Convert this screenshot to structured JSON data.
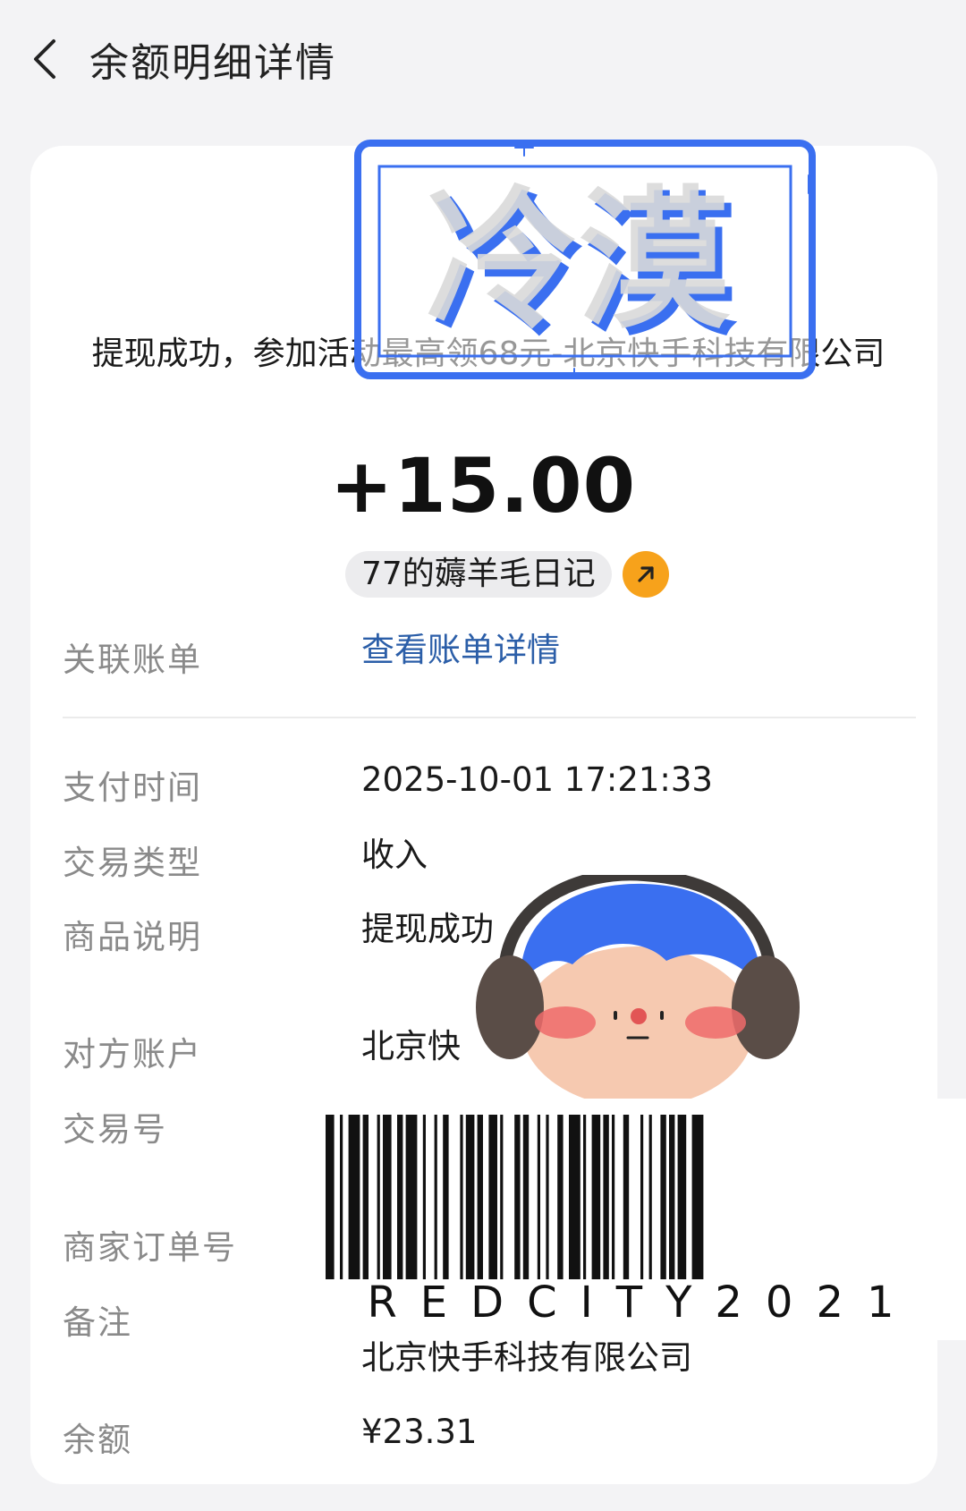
{
  "header": {
    "title": "余额明细详情",
    "back_icon": "chevron-left-icon"
  },
  "summary": {
    "description": "提现成功，参加活动最高领68元-北京快手科技有限公司",
    "amount": "+15.00",
    "chip_label": "77的薅羊毛日记",
    "chip_icon": "arrow-up-right-icon",
    "chip_icon_color": "#f7a21b"
  },
  "related": {
    "label": "关联账单",
    "link_text": "查看账单详情",
    "link_color": "#2b5ea8"
  },
  "details": {
    "pay_time": {
      "label": "支付时间",
      "value": "2025-10-01 17:21:33"
    },
    "trade_type": {
      "label": "交易类型",
      "value": "收入"
    },
    "product_desc": {
      "label": "商品说明",
      "value": "提现成功"
    },
    "counterparty": {
      "label": "对方账户",
      "value": "北京快"
    },
    "trade_no": {
      "label": "交易号"
    },
    "order_no": {
      "label": "商家订单号"
    },
    "remark": {
      "label": "备注",
      "value": "北京快手科技有限公司"
    },
    "balance": {
      "label": "余额",
      "value": "¥23.31"
    }
  },
  "overlays": {
    "stamp": {
      "text": "冷漠",
      "color": "#3a6ff0"
    },
    "barcode": {
      "text": "REDCITY2021"
    },
    "face": {
      "hair_color": "#3a6ff0"
    }
  }
}
